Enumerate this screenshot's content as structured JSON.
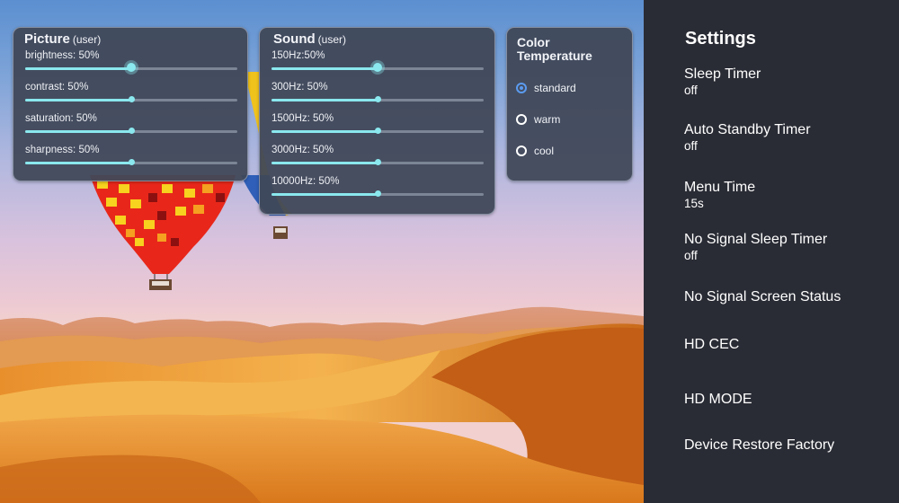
{
  "picture": {
    "title": "Picture",
    "mode": "(user)",
    "sliders": [
      {
        "label": "brightness: 50%",
        "value": 50,
        "focused": true
      },
      {
        "label": "contrast: 50%",
        "value": 50,
        "focused": false
      },
      {
        "label": "saturation: 50%",
        "value": 50,
        "focused": false
      },
      {
        "label": "sharpness: 50%",
        "value": 50,
        "focused": false
      }
    ]
  },
  "sound": {
    "title": "Sound",
    "mode": "(user)",
    "sliders": [
      {
        "label": "150Hz:50%",
        "value": 50,
        "focused": true
      },
      {
        "label": "300Hz: 50%",
        "value": 50,
        "focused": false
      },
      {
        "label": "1500Hz: 50%",
        "value": 50,
        "focused": false
      },
      {
        "label": "3000Hz: 50%",
        "value": 50,
        "focused": false
      },
      {
        "label": "10000Hz: 50%",
        "value": 50,
        "focused": false
      }
    ]
  },
  "color_temperature": {
    "title_line1": "Color",
    "title_line2": "Temperature",
    "options": [
      {
        "label": "standard",
        "selected": true
      },
      {
        "label": "warm",
        "selected": false
      },
      {
        "label": "cool",
        "selected": false
      }
    ]
  },
  "settings": {
    "title": "Settings",
    "items": [
      {
        "label": "Sleep Timer",
        "value": "off"
      },
      {
        "label": "Auto Standby Timer",
        "value": "off"
      },
      {
        "label": "Menu Time",
        "value": "15s"
      },
      {
        "label": "No Signal Sleep Timer",
        "value": "off"
      },
      {
        "label": "No Signal Screen Status",
        "value": null
      },
      {
        "label": "HD CEC",
        "value": null
      },
      {
        "label": "HD MODE",
        "value": null
      },
      {
        "label": "Device Restore Factory",
        "value": null
      }
    ]
  },
  "colors": {
    "slider_accent": "#8ae8ee",
    "radio_accent": "#5b9bf0",
    "panel_bg": "#404858",
    "sidebar_bg": "#2a2c35"
  }
}
